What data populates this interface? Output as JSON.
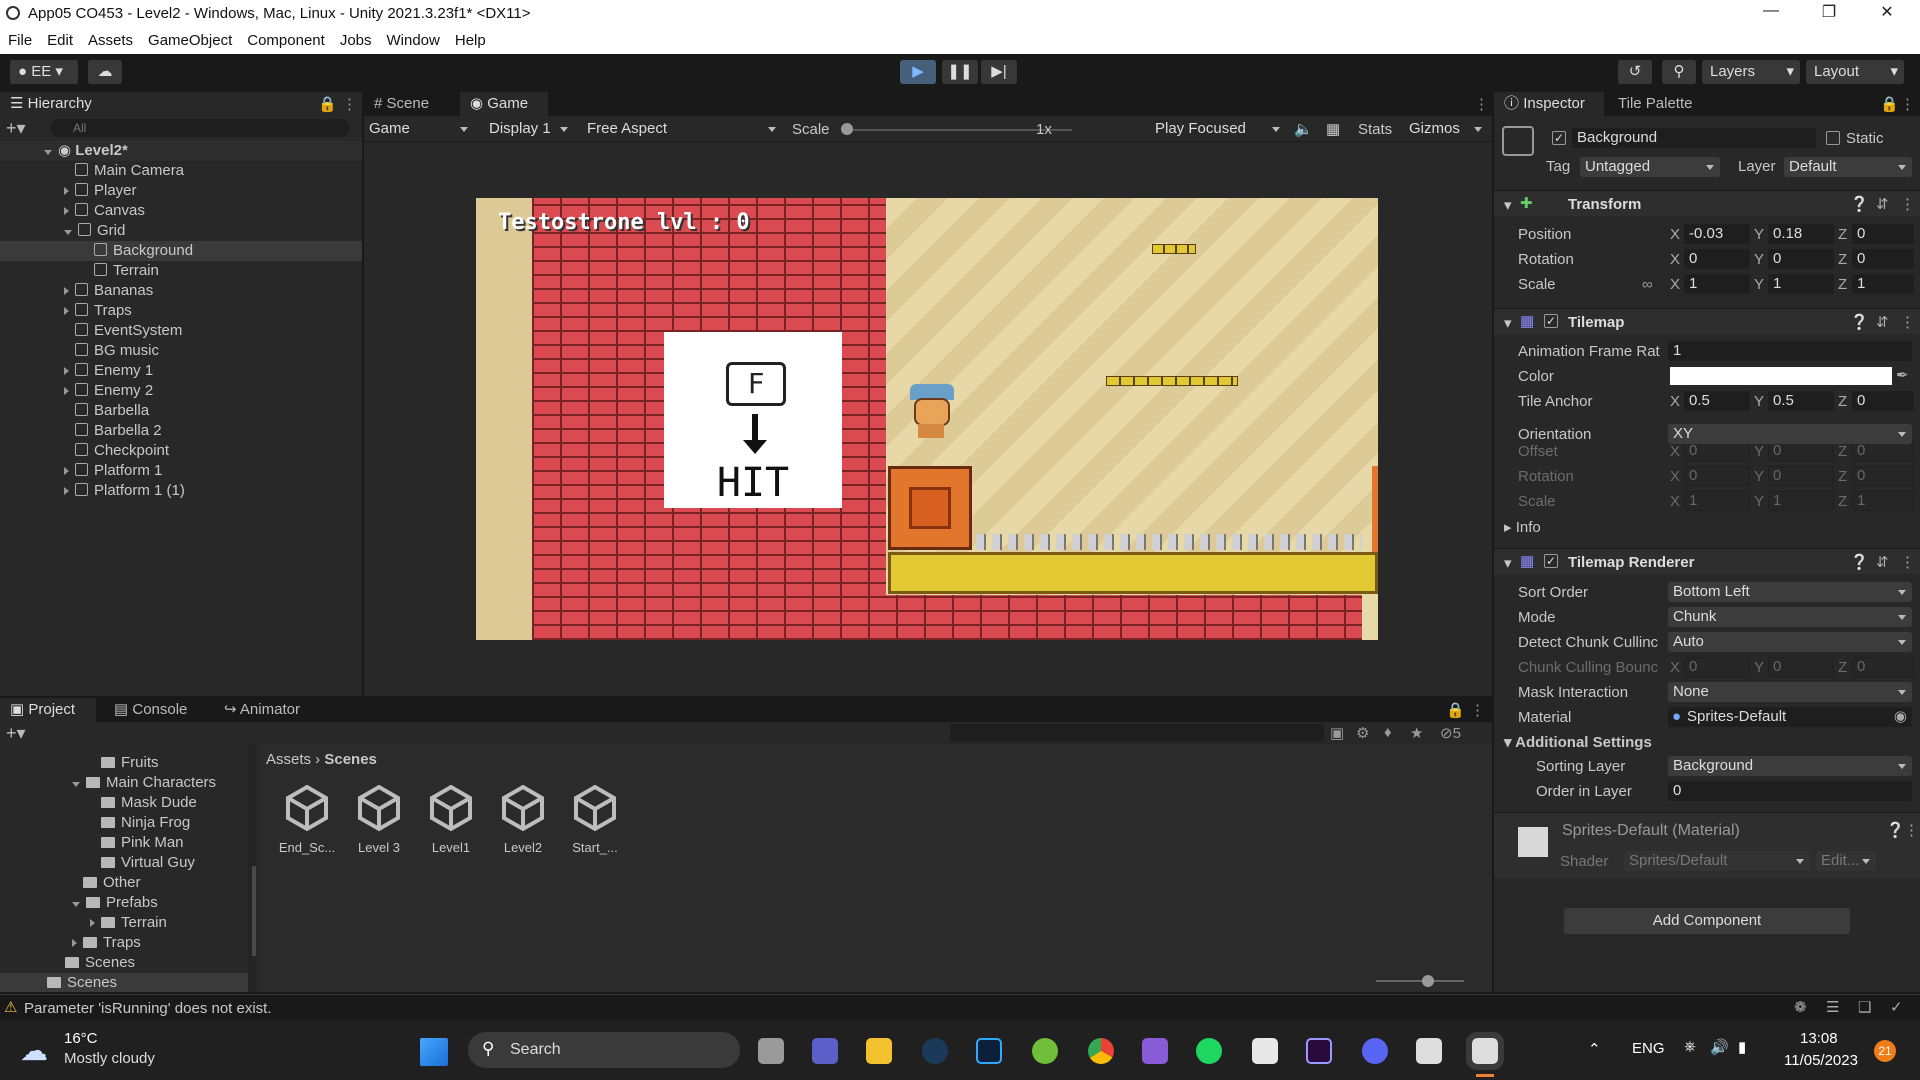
{
  "window": {
    "title": "App05 CO453 - Level2 - Windows, Mac, Linux - Unity 2021.3.23f1* <DX11>"
  },
  "menu": [
    "File",
    "Edit",
    "Assets",
    "GameObject",
    "Component",
    "Jobs",
    "Window",
    "Help"
  ],
  "toolbar": {
    "account": "EE",
    "layers": "Layers",
    "layout": "Layout"
  },
  "hierarchy": {
    "tab": "Hierarchy",
    "search_placeholder": "All",
    "scene": "Level2*",
    "items": [
      {
        "label": "Main Camera",
        "expand": false
      },
      {
        "label": "Player",
        "expand": true
      },
      {
        "label": "Canvas",
        "expand": true
      },
      {
        "label": "Grid",
        "expand": "open"
      },
      {
        "label": "Background",
        "child": true,
        "selected": true
      },
      {
        "label": "Terrain",
        "child": true
      },
      {
        "label": "Bananas",
        "expand": true
      },
      {
        "label": "Traps",
        "expand": true
      },
      {
        "label": "EventSystem",
        "expand": false
      },
      {
        "label": "BG music",
        "expand": false
      },
      {
        "label": "Enemy 1",
        "expand": true
      },
      {
        "label": "Enemy 2",
        "expand": true
      },
      {
        "label": "Barbella",
        "expand": false
      },
      {
        "label": "Barbella 2",
        "expand": false
      },
      {
        "label": "Checkpoint",
        "expand": false
      },
      {
        "label": "Platform 1",
        "expand": true
      },
      {
        "label": "Platform 1 (1)",
        "expand": true
      }
    ]
  },
  "game_view": {
    "tabs": [
      "Scene",
      "Game"
    ],
    "mode": "Game",
    "display": "Display 1",
    "aspect": "Free Aspect",
    "scale_label": "Scale",
    "scale_value": "1x",
    "play_focused": "Play Focused",
    "stats": "Stats",
    "gizmos": "Gizmos",
    "hud_text": "Testostrone lvl : 0",
    "sign_key": "F",
    "sign_text": "HIT"
  },
  "inspector": {
    "tabs": [
      "Inspector",
      "Tile Palette"
    ],
    "object_name": "Background",
    "static_label": "Static",
    "tag_label": "Tag",
    "tag_value": "Untagged",
    "layer_label": "Layer",
    "layer_value": "Default",
    "transform": {
      "title": "Transform",
      "position_label": "Position",
      "position": [
        "-0.03",
        "0.18",
        "0"
      ],
      "rotation_label": "Rotation",
      "rotation": [
        "0",
        "0",
        "0"
      ],
      "scale_label": "Scale",
      "scale": [
        "1",
        "1",
        "1"
      ]
    },
    "tilemap": {
      "title": "Tilemap",
      "anim_label": "Animation Frame Rat",
      "anim_value": "1",
      "color_label": "Color",
      "color_value": "#ffffff",
      "anchor_label": "Tile Anchor",
      "anchor": [
        "0.5",
        "0.5",
        "0"
      ],
      "orientation_label": "Orientation",
      "orientation_value": "XY",
      "offset_label": "Offset",
      "offset": [
        "0",
        "0",
        "0"
      ],
      "rotation_label": "Rotation",
      "rotation": [
        "0",
        "0",
        "0"
      ],
      "scale_label": "Scale",
      "scale": [
        "1",
        "1",
        "1"
      ],
      "info_label": "Info"
    },
    "renderer": {
      "title": "Tilemap Renderer",
      "sort_label": "Sort Order",
      "sort_value": "Bottom Left",
      "mode_label": "Mode",
      "mode_value": "Chunk",
      "culling_label": "Detect Chunk Cullinc",
      "culling_value": "Auto",
      "bounds_label": "Chunk Culling Bounc",
      "bounds": [
        "0",
        "0",
        "0"
      ],
      "mask_label": "Mask Interaction",
      "mask_value": "None",
      "material_label": "Material",
      "material_value": "Sprites-Default",
      "additional_label": "Additional Settings",
      "sorting_layer_label": "Sorting Layer",
      "sorting_layer_value": "Background",
      "order_label": "Order in Layer",
      "order_value": "0"
    },
    "material": {
      "name": "Sprites-Default (Material)",
      "shader_label": "Shader",
      "shader_value": "Sprites/Default",
      "edit": "Edit..."
    },
    "add_component": "Add Component",
    "axes": [
      "X",
      "Y",
      "Z"
    ]
  },
  "project": {
    "tabs": [
      "Project",
      "Console",
      "Animator"
    ],
    "hidden_count": "5",
    "breadcrumb": [
      "Assets",
      "Scenes"
    ],
    "tree": [
      {
        "label": "Fruits",
        "indent": 3
      },
      {
        "label": "Main Characters",
        "indent": 2,
        "open": true
      },
      {
        "label": "Mask Dude",
        "indent": 3
      },
      {
        "label": "Ninja Frog",
        "indent": 3
      },
      {
        "label": "Pink Man",
        "indent": 3
      },
      {
        "label": "Virtual Guy",
        "indent": 3
      },
      {
        "label": "Other",
        "indent": 2
      },
      {
        "label": "Prefabs",
        "indent": 2,
        "open": true
      },
      {
        "label": "Terrain",
        "indent": 3,
        "arrow": true
      },
      {
        "label": "Traps",
        "indent": 2,
        "arrow": true
      },
      {
        "label": "Scenes",
        "indent": 1
      },
      {
        "label": "Scenes",
        "indent": 0
      }
    ],
    "assets": [
      "End_Sc...",
      "Level 3",
      "Level1",
      "Level2",
      "Start_..."
    ]
  },
  "status": {
    "message": "Parameter 'isRunning' does not exist."
  },
  "taskbar": {
    "temperature": "16°C",
    "weather": "Mostly cloudy",
    "search": "Search",
    "language": "ENG",
    "time": "13:08",
    "date": "11/05/2023",
    "notification_count": "21"
  }
}
